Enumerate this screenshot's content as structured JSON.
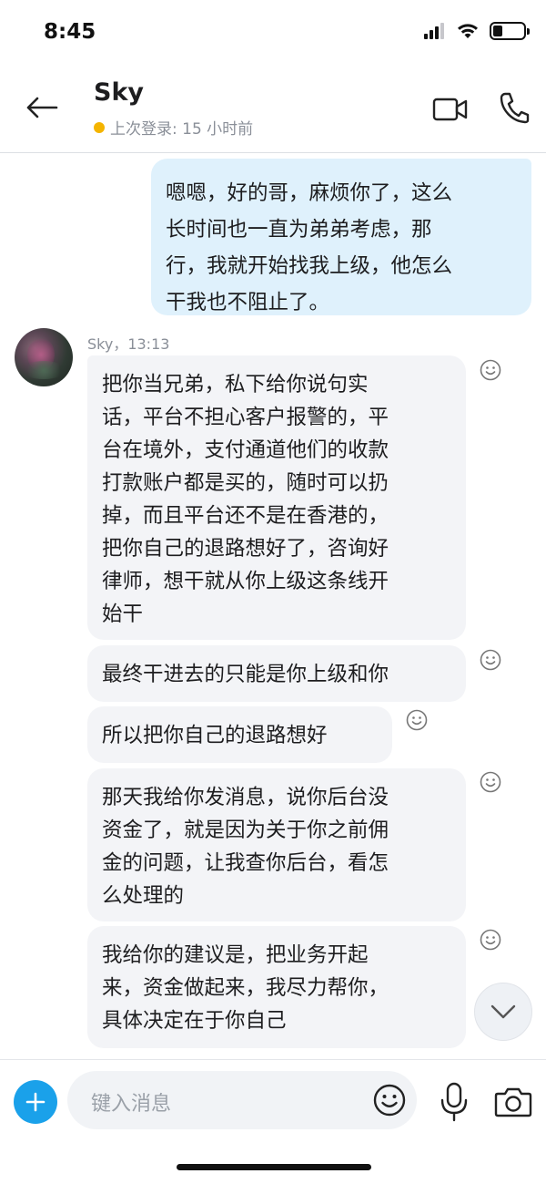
{
  "status_bar": {
    "time": "8:45",
    "battery_level": 0.3,
    "icons": [
      "signal-icon",
      "wifi-icon",
      "battery-icon"
    ]
  },
  "header": {
    "contact_name": "Sky",
    "last_seen": "上次登录: 15 小时前",
    "status_color": "#f4b400",
    "icons": [
      "back-arrow-icon",
      "video-call-icon",
      "phone-icon"
    ]
  },
  "messages": {
    "outgoing": [
      {
        "lines": [
          "嗯嗯，好的哥，麻烦你了，这么",
          "长时间也一直为弟弟考虑，那",
          "行，我就开始找我上级，他怎么",
          "干我也不阻止了。"
        ]
      }
    ],
    "incoming_sender": "Sky，13:13",
    "incoming": [
      {
        "lines": [
          "把你当兄弟，私下给你说句实",
          "话，平台不担心客户报警的，平",
          "台在境外，支付通道他们的收款",
          "打款账户都是买的，随时可以扔",
          "掉，而且平台还不是在香港的，",
          "把你自己的退路想好了，咨询好",
          "律师，想干就从你上级这条线开",
          "始干"
        ]
      },
      {
        "lines": [
          "最终干进去的只能是你上级和你"
        ]
      },
      {
        "lines": [
          "所以把你自己的退路想好"
        ]
      },
      {
        "lines": [
          "那天我给你发消息，说你后台没",
          "资金了，就是因为关于你之前佣",
          "金的问题，让我查你后台，看怎",
          "么处理的"
        ]
      },
      {
        "lines": [
          "我给你的建议是，把业务开起",
          "来，资金做起来，我尽力帮你，",
          "具体决定在于你自己"
        ]
      }
    ]
  },
  "composer": {
    "placeholder": "键入消息",
    "icons": [
      "plus-icon",
      "emoji-icon",
      "microphone-icon",
      "camera-icon"
    ]
  },
  "colors": {
    "accent": "#1aa1ea",
    "outgoing_bubble": "#dff1fc",
    "incoming_bubble": "#f3f4f7",
    "muted_text": "#8a8f98"
  }
}
